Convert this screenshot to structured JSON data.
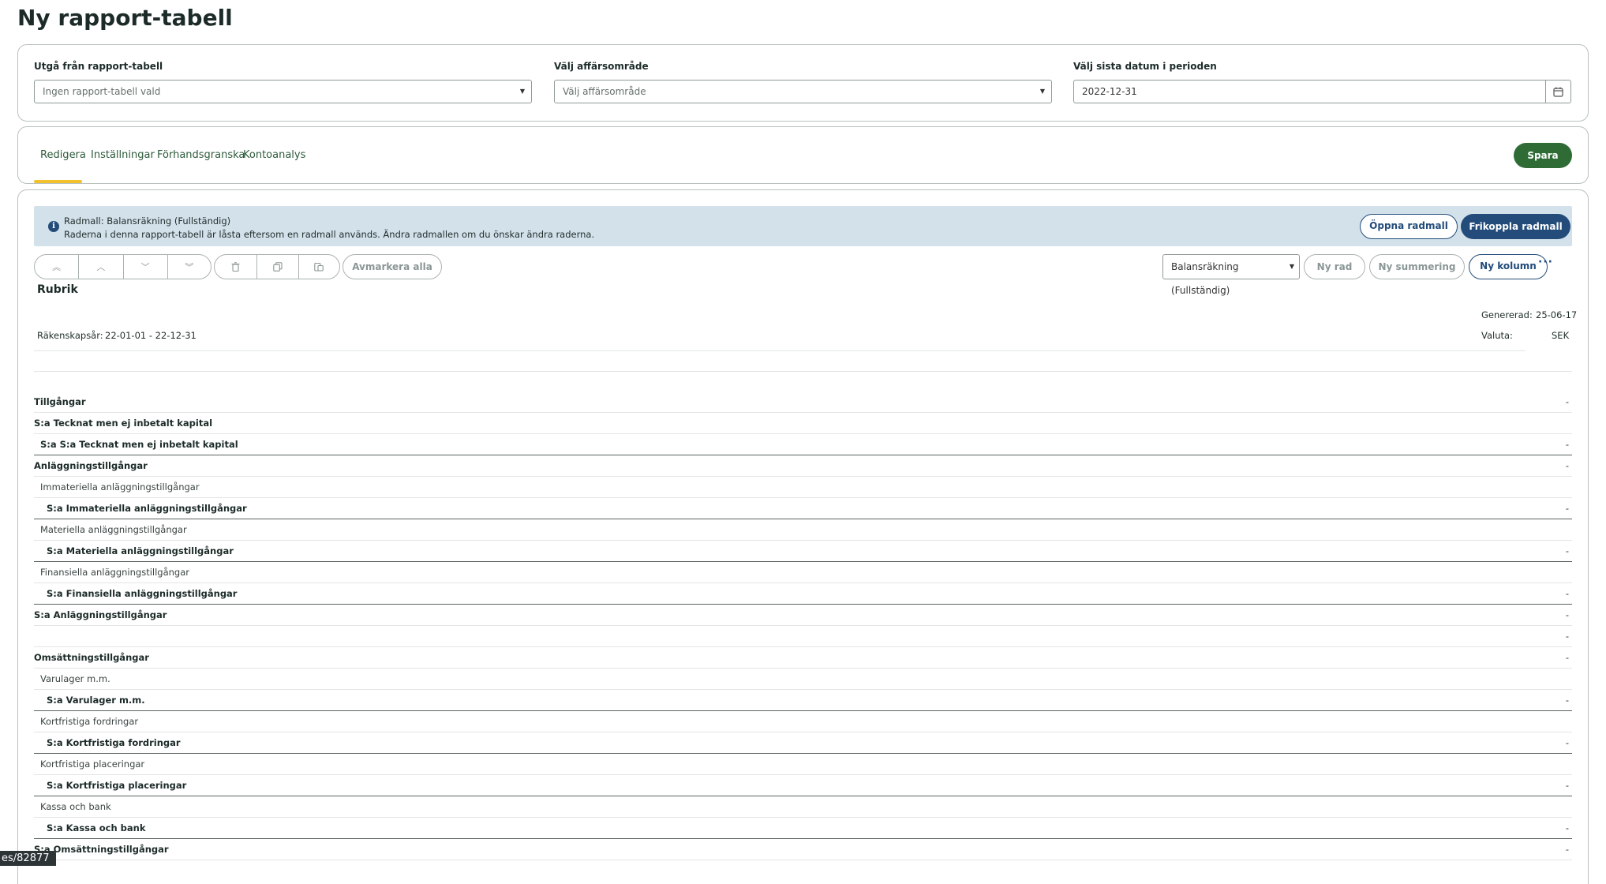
{
  "page": {
    "title": "Ny rapport-tabell"
  },
  "filters": {
    "base_label": "Utgå från rapport-tabell",
    "base_value": "Ingen rapport-tabell vald",
    "area_label": "Välj affärsområde",
    "area_value": "Välj affärsområde",
    "date_label": "Välj sista datum i perioden",
    "date_value": "2022-12-31"
  },
  "tabs": [
    "Redigera",
    "Inställningar",
    "Förhandsgranska",
    "Kontoanalys"
  ],
  "actions": {
    "save": "Spara"
  },
  "banner": {
    "line1": "Radmall: Balansräkning (Fullständig)",
    "line2": "Raderna i denna rapport-tabell är låsta eftersom en radmall används. Ändra radmallen om du önskar ändra raderna.",
    "open_template": "Öppna radmall",
    "detach_template": "Frikoppla radmall"
  },
  "toolbar": {
    "deselect_all": "Avmarkera alla",
    "template_select": "Balansräkning (Fullständig)",
    "new_row": "Ny rad",
    "new_sum": "Ny summering",
    "new_column": "Ny kolumn",
    "more": "···"
  },
  "report": {
    "heading": "Rubrik",
    "generated_label": "Genererad:",
    "generated_value": "25-06-17",
    "fiscal_label": "Räkenskapsår:",
    "fiscal_value": "22-01-01 - 22-12-31",
    "currency_label": "Valuta:",
    "currency_value": "SEK",
    "rows": [
      {
        "label": "Tillgångar",
        "value": "-",
        "bold": true,
        "level": 0,
        "sum": false
      },
      {
        "label": "S:a Tecknat men ej inbetalt kapital",
        "value": "",
        "bold": true,
        "level": 0,
        "sum": false
      },
      {
        "label": "S:a S:a Tecknat men ej inbetalt kapital",
        "value": "-",
        "bold": true,
        "level": 1,
        "sum": true
      },
      {
        "label": "Anläggningstillgångar",
        "value": "-",
        "bold": true,
        "level": 0,
        "sum": false
      },
      {
        "label": "Immateriella anläggningstillgångar",
        "value": "",
        "bold": false,
        "level": 1,
        "sum": false
      },
      {
        "label": "S:a Immateriella anläggningstillgångar",
        "value": "-",
        "bold": true,
        "level": 2,
        "sum": true
      },
      {
        "label": "Materiella anläggningstillgångar",
        "value": "",
        "bold": false,
        "level": 1,
        "sum": false
      },
      {
        "label": "S:a Materiella anläggningstillgångar",
        "value": "-",
        "bold": true,
        "level": 2,
        "sum": true
      },
      {
        "label": "Finansiella anläggningstillgångar",
        "value": "",
        "bold": false,
        "level": 1,
        "sum": false
      },
      {
        "label": "S:a Finansiella anläggningstillgångar",
        "value": "-",
        "bold": true,
        "level": 2,
        "sum": true
      },
      {
        "label": "S:a Anläggningstillgångar",
        "value": "-",
        "bold": true,
        "level": 0,
        "sum": false
      },
      {
        "label": "",
        "value": "-",
        "bold": false,
        "level": 0,
        "sum": false
      },
      {
        "label": "Omsättningstillgångar",
        "value": "-",
        "bold": true,
        "level": 0,
        "sum": false
      },
      {
        "label": "Varulager m.m.",
        "value": "",
        "bold": false,
        "level": 1,
        "sum": false
      },
      {
        "label": "S:a Varulager m.m.",
        "value": "-",
        "bold": true,
        "level": 2,
        "sum": true
      },
      {
        "label": "Kortfristiga fordringar",
        "value": "",
        "bold": false,
        "level": 1,
        "sum": false
      },
      {
        "label": "S:a Kortfristiga fordringar",
        "value": "-",
        "bold": true,
        "level": 2,
        "sum": true
      },
      {
        "label": "Kortfristiga placeringar",
        "value": "",
        "bold": false,
        "level": 1,
        "sum": false
      },
      {
        "label": "S:a Kortfristiga placeringar",
        "value": "-",
        "bold": true,
        "level": 2,
        "sum": true
      },
      {
        "label": "Kassa och bank",
        "value": "",
        "bold": false,
        "level": 1,
        "sum": false
      },
      {
        "label": "S:a Kassa och bank",
        "value": "-",
        "bold": true,
        "level": 2,
        "sum": true
      },
      {
        "label": "S:a Omsättningstillgångar",
        "value": "-",
        "bold": true,
        "level": 0,
        "sum": false
      }
    ]
  },
  "status": {
    "url_fragment": "es/82877"
  },
  "colors": {
    "primary_green": "#2e6b35",
    "primary_blue": "#234c7a",
    "banner_bg": "#d3e1eb",
    "tab_accent": "#f2c12e"
  }
}
